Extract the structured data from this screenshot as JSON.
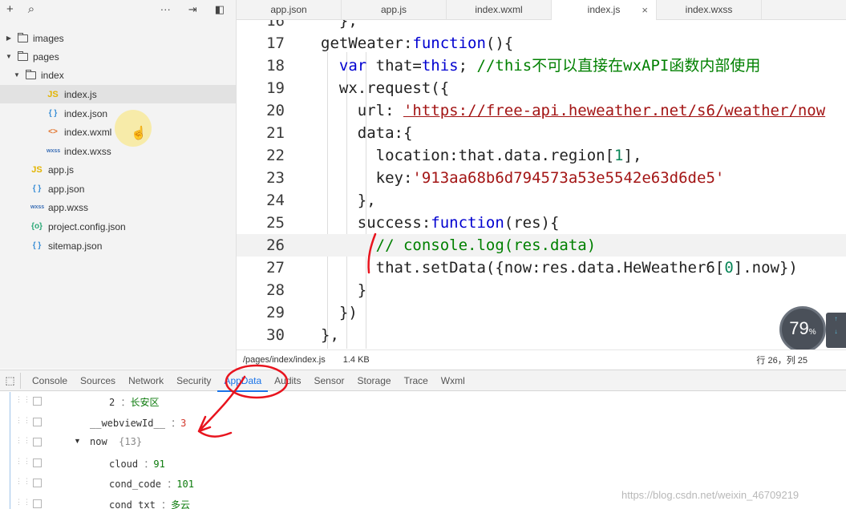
{
  "sidebar": {
    "toolbar": {
      "add": "+",
      "search": "⌕",
      "more": "···",
      "sort": "⇥",
      "collapse": "◧"
    },
    "tree": [
      {
        "label": "images",
        "kind": "folder",
        "arrow": "▶",
        "indent": 0
      },
      {
        "label": "pages",
        "kind": "folder-open",
        "arrow": "▼",
        "indent": 0
      },
      {
        "label": "index",
        "kind": "folder-open",
        "arrow": "▼",
        "indent": 1
      },
      {
        "label": "index.js",
        "kind": "js",
        "icon": "JS",
        "indent": 2,
        "selected": true
      },
      {
        "label": "index.json",
        "kind": "json",
        "icon": "{ }",
        "indent": 2
      },
      {
        "label": "index.wxml",
        "kind": "wxml",
        "icon": "<>",
        "indent": 2
      },
      {
        "label": "index.wxss",
        "kind": "wxss",
        "icon": "wxss",
        "indent": 2
      },
      {
        "label": "app.js",
        "kind": "js",
        "icon": "JS",
        "indent": 1
      },
      {
        "label": "app.json",
        "kind": "json",
        "icon": "{ }",
        "indent": 1
      },
      {
        "label": "app.wxss",
        "kind": "wxss",
        "icon": "wxss",
        "indent": 1
      },
      {
        "label": "project.config.json",
        "kind": "cfg",
        "icon": "{o}",
        "indent": 1
      },
      {
        "label": "sitemap.json",
        "kind": "json",
        "icon": "{ }",
        "indent": 1
      }
    ]
  },
  "tabs": [
    {
      "label": "app.json"
    },
    {
      "label": "app.js"
    },
    {
      "label": "index.wxml"
    },
    {
      "label": "index.js",
      "active": true,
      "close": "×"
    },
    {
      "label": "index.wxss"
    }
  ],
  "code": [
    {
      "n": "16",
      "tokens": [
        [
          "c-def",
          "  },"
        ]
      ]
    },
    {
      "n": "17",
      "tokens": [
        [
          "c-def",
          "getWeater:"
        ],
        [
          "c-kw",
          "function"
        ],
        [
          "c-def",
          "(){"
        ]
      ]
    },
    {
      "n": "18",
      "tokens": [
        [
          "c-def",
          "  "
        ],
        [
          "c-kw",
          "var"
        ],
        [
          "c-def",
          " that="
        ],
        [
          "c-kw",
          "this"
        ],
        [
          "c-def",
          "; "
        ],
        [
          "c-com",
          "//this不可以直接在wxAPI函数内部使用"
        ]
      ]
    },
    {
      "n": "19",
      "tokens": [
        [
          "c-def",
          "  wx.request({"
        ]
      ]
    },
    {
      "n": "20",
      "tokens": [
        [
          "c-def",
          "    url: "
        ],
        [
          "c-str url-ul",
          "'https://free-api.heweather.net/s6/weather/now"
        ]
      ]
    },
    {
      "n": "21",
      "tokens": [
        [
          "c-def",
          "    data:{"
        ]
      ]
    },
    {
      "n": "22",
      "tokens": [
        [
          "c-def",
          "      location:that.data.region["
        ],
        [
          "c-num",
          "1"
        ],
        [
          "c-def",
          "],"
        ]
      ]
    },
    {
      "n": "23",
      "tokens": [
        [
          "c-def",
          "      key:"
        ],
        [
          "c-str",
          "'913aa68b6d794573a53e5542e63d6de5'"
        ]
      ]
    },
    {
      "n": "24",
      "tokens": [
        [
          "c-def",
          "    },"
        ]
      ]
    },
    {
      "n": "25",
      "tokens": [
        [
          "c-def",
          "    success:"
        ],
        [
          "c-kw",
          "function"
        ],
        [
          "c-def",
          "(res){"
        ]
      ]
    },
    {
      "n": "26",
      "tokens": [
        [
          "c-def",
          "      "
        ],
        [
          "c-com",
          "// console.log(res.data)"
        ]
      ],
      "highlight": true
    },
    {
      "n": "27",
      "tokens": [
        [
          "c-def",
          "      that.setData({now:res.data.HeWeather6["
        ],
        [
          "c-num",
          "0"
        ],
        [
          "c-def",
          "].now})"
        ]
      ]
    },
    {
      "n": "28",
      "tokens": [
        [
          "c-def",
          "    }"
        ]
      ]
    },
    {
      "n": "29",
      "tokens": [
        [
          "c-def",
          "  })"
        ]
      ]
    },
    {
      "n": "30",
      "tokens": [
        [
          "c-def",
          "},"
        ]
      ]
    }
  ],
  "perf": {
    "value": "79",
    "unit": "%",
    "up": "↑",
    "down": "↓"
  },
  "statusbar": {
    "path": "/pages/index/index.js",
    "size": "1.4 KB",
    "position": "行 26，列 25"
  },
  "devtools": {
    "inspect_icon": "⬚",
    "tabs": [
      "Console",
      "Sources",
      "Network",
      "Security",
      "AppData",
      "Audits",
      "Sensor",
      "Storage",
      "Trace",
      "Wxml"
    ],
    "active_tab": "AppData",
    "rows": [
      {
        "key": "2",
        "sep": " ：",
        "value": "长安区",
        "value_class": "aval",
        "indent": 136
      },
      {
        "key": "__webviewId__",
        "sep": " ：",
        "value": "3",
        "value_class": "aval red",
        "indent": 112
      },
      {
        "key": "now",
        "sep": "  ",
        "value": "{13}",
        "value_class": "acount",
        "indent": 112,
        "expand": "▼"
      },
      {
        "key": "cloud",
        "sep": " ：",
        "value": "91",
        "value_class": "aval num",
        "indent": 136
      },
      {
        "key": "cond_code",
        "sep": " ：",
        "value": "101",
        "value_class": "aval num",
        "indent": 136
      },
      {
        "key": "cond_txt",
        "sep": " ：",
        "value": "多云",
        "value_class": "aval",
        "indent": 136
      }
    ]
  },
  "watermark": "https://blog.csdn.net/weixin_46709219"
}
